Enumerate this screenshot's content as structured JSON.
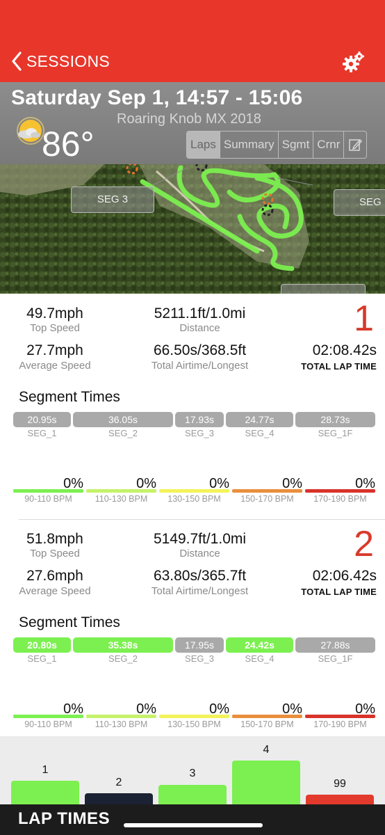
{
  "nav": {
    "back_label": "SESSIONS"
  },
  "header": {
    "title": "Saturday Sep 1, 14:57 - 15:06",
    "track": "Roaring Knob MX 2018",
    "temperature": "86°",
    "tabs": [
      {
        "label": "Laps",
        "active": true
      },
      {
        "label": "Summary",
        "active": false
      },
      {
        "label": "Sgmt",
        "active": false
      },
      {
        "label": "Crnr",
        "active": false
      }
    ]
  },
  "map": {
    "labels": [
      "SEG 3",
      "SEG"
    ]
  },
  "sessions": [
    {
      "lap_number": "1",
      "top_speed": "49.7mph",
      "top_speed_label": "Top Speed",
      "distance": "5211.1ft/1.0mi",
      "distance_label": "Distance",
      "avg_speed": "27.7mph",
      "avg_speed_label": "Average Speed",
      "airtime": "66.50s/368.5ft",
      "airtime_label": "Total Airtime/Longest",
      "lap_time": "02:08.42s",
      "lap_time_label": "TOTAL LAP TIME",
      "segment_title": "Segment Times",
      "segments": [
        {
          "time": "20.95s",
          "label": "SEG_1",
          "highlight": false
        },
        {
          "time": "36.05s",
          "label": "SEG_2",
          "highlight": false
        },
        {
          "time": "17.93s",
          "label": "SEG_3",
          "highlight": false
        },
        {
          "time": "24.77s",
          "label": "SEG_4",
          "highlight": false
        },
        {
          "time": "28.73s",
          "label": "SEG_1F",
          "highlight": false
        }
      ],
      "bpm": [
        {
          "pct": "0%",
          "label": "90-110 BPM",
          "color": "#7cf050"
        },
        {
          "pct": "0%",
          "label": "110-130 BPM",
          "color": "#c5f26a"
        },
        {
          "pct": "0%",
          "label": "130-150 BPM",
          "color": "#f3f35a"
        },
        {
          "pct": "0%",
          "label": "150-170 BPM",
          "color": "#e98f3c"
        },
        {
          "pct": "0%",
          "label": "170-190 BPM",
          "color": "#d8332a"
        }
      ]
    },
    {
      "lap_number": "2",
      "top_speed": "51.8mph",
      "top_speed_label": "Top Speed",
      "distance": "5149.7ft/1.0mi",
      "distance_label": "Distance",
      "avg_speed": "27.6mph",
      "avg_speed_label": "Average Speed",
      "airtime": "63.80s/365.7ft",
      "airtime_label": "Total Airtime/Longest",
      "lap_time": "02:06.42s",
      "lap_time_label": "TOTAL LAP TIME",
      "segment_title": "Segment Times",
      "segments": [
        {
          "time": "20.80s",
          "label": "SEG_1",
          "highlight": true
        },
        {
          "time": "35.38s",
          "label": "SEG_2",
          "highlight": true
        },
        {
          "time": "17.95s",
          "label": "SEG_3",
          "highlight": false
        },
        {
          "time": "24.42s",
          "label": "SEG_4",
          "highlight": true
        },
        {
          "time": "27.88s",
          "label": "SEG_1F",
          "highlight": false
        }
      ],
      "bpm": [
        {
          "pct": "0%",
          "label": "90-110 BPM",
          "color": "#7cf050"
        },
        {
          "pct": "0%",
          "label": "110-130 BPM",
          "color": "#c5f26a"
        },
        {
          "pct": "0%",
          "label": "130-150 BPM",
          "color": "#f3f35a"
        },
        {
          "pct": "0%",
          "label": "150-170 BPM",
          "color": "#e98f3c"
        },
        {
          "pct": "0%",
          "label": "170-190 BPM",
          "color": "#d8332a"
        }
      ]
    }
  ],
  "lap_chart": {
    "title": "LAP TIMES",
    "bars": [
      {
        "label": "1",
        "color": "#7cf050"
      },
      {
        "label": "2",
        "color": "#1a2233"
      },
      {
        "label": "3",
        "color": "#7cf050"
      },
      {
        "label": "4",
        "color": "#7cf050"
      },
      {
        "label": "99",
        "color": "#e33a2e"
      }
    ]
  }
}
